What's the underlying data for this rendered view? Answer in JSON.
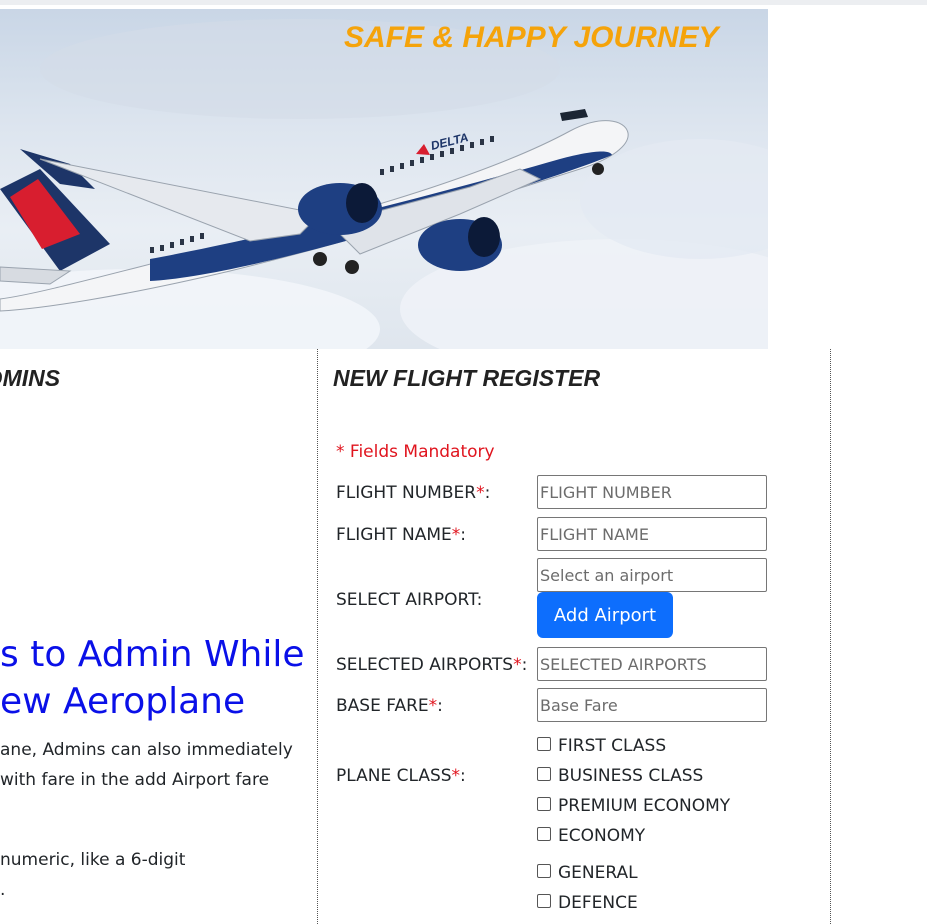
{
  "hero": {
    "slogan": "SAFE & HAPPY JOURNEY",
    "image_name": "delta-airplane-image",
    "fuselage_text": "DELTA"
  },
  "left": {
    "heading": "DMINS",
    "promo_title_line1": "s to Admin While",
    "promo_title_line2": "ew Aeroplane",
    "promo_lines": [
      "ane, Admins can also immediately",
      " with fare in the add Airport fare",
      "numeric, like a 6-digit",
      "."
    ]
  },
  "form": {
    "heading": "NEW FLIGHT REGISTER",
    "mandatory_note": "* Fields Mandatory",
    "required_mark": "*",
    "flight_number_label": "FLIGHT NUMBER",
    "flight_number_placeholder": "FLIGHT NUMBER",
    "flight_name_label": "FLIGHT NAME",
    "flight_name_placeholder": "FLIGHT NAME",
    "select_airport_label": "SELECT AIRPORT:",
    "select_airport_placeholder": "Select an airport",
    "add_airport_button": "Add Airport",
    "selected_airports_label": "SELECTED AIRPORTS",
    "selected_airports_placeholder": "SELECTED AIRPORTS",
    "base_fare_label": "BASE FARE",
    "base_fare_placeholder": "Base Fare",
    "plane_class_label": "PLANE CLASS",
    "classes": [
      "FIRST CLASS",
      "BUSINESS CLASS",
      "PREMIUM ECONOMY",
      "ECONOMY"
    ],
    "categories": [
      "GENERAL",
      "DEFENCE"
    ]
  },
  "colors": {
    "slogan": "#f5a30a",
    "promo_title": "#0a10e8",
    "required": "#e0141e",
    "button": "#0d6efd"
  }
}
